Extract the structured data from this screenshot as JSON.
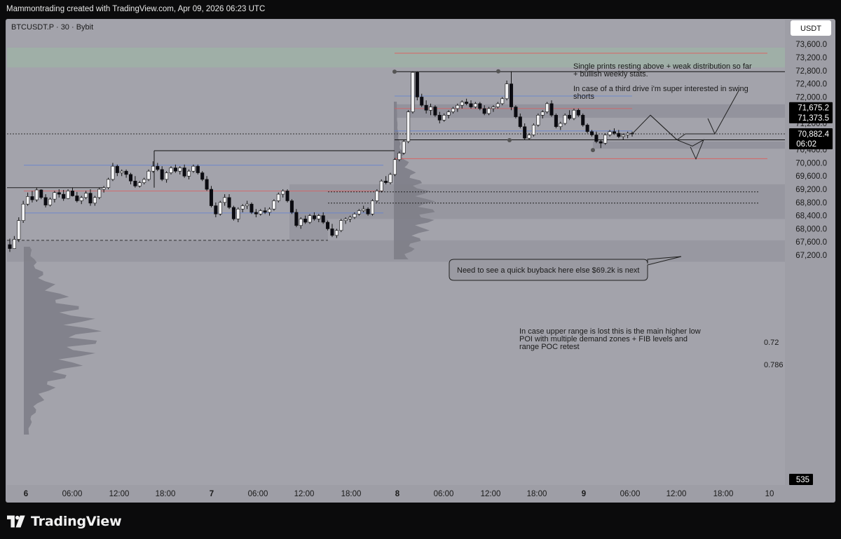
{
  "header": {
    "credit": "Mammontrading created with TradingView.com, Apr 09, 2026 06:23 UTC"
  },
  "symbol_label": "BTCUSDT.P · 30 · Bybit",
  "currency_button": "USDT",
  "brand": {
    "name": "TradingView",
    "logo_icon": "tradingview-logo-icon"
  },
  "colors": {
    "chart_bg": "#a3a3ab",
    "zone_green": "#9fb2a6",
    "zone_dark": "#91919a",
    "candle_bull": "#f2f2f4",
    "candle_bear": "#0b0b12",
    "line_red": "#e05a5a",
    "line_blue": "#5c7fd6",
    "tag_bg": "#000000"
  },
  "annotations": {
    "note_top_1": "Single prints resting above + weak distribution so far",
    "note_top_2": "+ bullish weekly stats.",
    "note_top_3": "In case of a third drive i'm super interested in swing",
    "note_top_4": "shorts",
    "callout": "Need to see a quick buyback here else $69.2k is next",
    "note_low_1": "In case upper range is lost this is the main higher low",
    "note_low_2": "POI with multiple demand zones + FIB levels and",
    "note_low_3": "range POC retest",
    "fib_072": "0.72",
    "fib_0786": "0.786"
  },
  "price_tags": {
    "tag1": "71,675.2",
    "tag2": "71,373.5",
    "last_price": "70,882.4",
    "countdown": "06:02",
    "volume": "535"
  },
  "chart_data": {
    "type": "candlestick",
    "title": "BTCUSDT.P · 30 · Bybit",
    "ylim": [
      67000,
      73900
    ],
    "y_ticks": [
      "73,600.0",
      "73,200.0",
      "72,800.0",
      "72,400.0",
      "72,000.0",
      "71,600.0",
      "71,200.0",
      "70,800.0",
      "70,400.0",
      "70,000.0",
      "69,600.0",
      "69,200.0",
      "68,800.0",
      "68,400.0",
      "68,000.0",
      "67,600.0",
      "67,200.0"
    ],
    "x_ticks": [
      "6",
      "06:00",
      "12:00",
      "18:00",
      "7",
      "06:00",
      "12:00",
      "18:00",
      "8",
      "06:00",
      "12:00",
      "18:00",
      "9",
      "06:00",
      "12:00",
      "18:00",
      "10"
    ],
    "key_levels": {
      "range_high": 72770,
      "range_low": 70700,
      "upper_red": 71650,
      "upper_blue": 72030,
      "upper_red_2": 73330,
      "mid_blue": 70970,
      "lower_red": 70130,
      "left_blue": 69930,
      "left_red": 69150,
      "left_blue_low": 68480,
      "fib_072": 69120,
      "fib_0786": 68780,
      "dashed_low": 67650
    },
    "zones": [
      {
        "name": "supply",
        "from": 72900,
        "to": 73500
      },
      {
        "name": "upper",
        "from": 71370,
        "to": 71780
      },
      {
        "name": "demand",
        "from": 70430,
        "to": 70650
      },
      {
        "name": "lower_demand",
        "from": 68300,
        "to": 69350
      },
      {
        "name": "bottom",
        "from": 67000,
        "to": 67650
      }
    ],
    "candles": [
      [
        67520,
        67700,
        67300,
        67400
      ],
      [
        67400,
        67780,
        67390,
        67680
      ],
      [
        67680,
        68350,
        67600,
        68250
      ],
      [
        68250,
        68850,
        68180,
        68750
      ],
      [
        68750,
        69100,
        68700,
        68980
      ],
      [
        68980,
        69150,
        68800,
        68880
      ],
      [
        68880,
        69250,
        68820,
        69180
      ],
      [
        69180,
        69200,
        68900,
        68950
      ],
      [
        68950,
        69050,
        68650,
        68720
      ],
      [
        68720,
        68950,
        68680,
        68900
      ],
      [
        68900,
        69150,
        68800,
        69100
      ],
      [
        69100,
        69200,
        68950,
        69050
      ],
      [
        69050,
        69180,
        68850,
        68920
      ],
      [
        68920,
        69200,
        68900,
        69150
      ],
      [
        69150,
        69250,
        68980,
        69000
      ],
      [
        69000,
        69120,
        68800,
        68850
      ],
      [
        68850,
        69000,
        68750,
        68950
      ],
      [
        68950,
        69150,
        68900,
        69080
      ],
      [
        69080,
        69200,
        68700,
        68780
      ],
      [
        68780,
        69000,
        68700,
        68950
      ],
      [
        68950,
        69250,
        68900,
        69200
      ],
      [
        69200,
        69300,
        69100,
        69250
      ],
      [
        69250,
        69550,
        69200,
        69500
      ],
      [
        69500,
        70000,
        69450,
        69900
      ],
      [
        69900,
        69950,
        69600,
        69700
      ],
      [
        69700,
        69800,
        69600,
        69750
      ],
      [
        69750,
        69800,
        69550,
        69650
      ],
      [
        69650,
        69700,
        69350,
        69450
      ],
      [
        69450,
        69600,
        69250,
        69300
      ],
      [
        69300,
        69450,
        69250,
        69400
      ],
      [
        69400,
        69550,
        69350,
        69500
      ],
      [
        69500,
        69800,
        69450,
        69750
      ],
      [
        69750,
        70050,
        69700,
        69900
      ],
      [
        69900,
        70000,
        69750,
        69800
      ],
      [
        69800,
        69900,
        69450,
        69500
      ],
      [
        69500,
        69750,
        69400,
        69700
      ],
      [
        69700,
        69900,
        69650,
        69850
      ],
      [
        69850,
        69950,
        69700,
        69750
      ],
      [
        69750,
        69900,
        69650,
        69850
      ],
      [
        69850,
        69950,
        69550,
        69600
      ],
      [
        69600,
        69800,
        69500,
        69750
      ],
      [
        69750,
        69950,
        69700,
        69900
      ],
      [
        69900,
        69950,
        69650,
        69700
      ],
      [
        69700,
        69750,
        69450,
        69500
      ],
      [
        69500,
        69600,
        69150,
        69200
      ],
      [
        69200,
        69300,
        68650,
        68700
      ],
      [
        68700,
        68800,
        68350,
        68450
      ],
      [
        68450,
        68850,
        68400,
        68800
      ],
      [
        68800,
        69050,
        68700,
        68950
      ],
      [
        68950,
        69050,
        68600,
        68650
      ],
      [
        68650,
        68700,
        68250,
        68300
      ],
      [
        68300,
        68650,
        68200,
        68600
      ],
      [
        68600,
        68750,
        68500,
        68700
      ],
      [
        68700,
        68850,
        68600,
        68750
      ],
      [
        68750,
        68800,
        68450,
        68500
      ],
      [
        68500,
        68600,
        68350,
        68450
      ],
      [
        68450,
        68600,
        68400,
        68550
      ],
      [
        68550,
        68650,
        68450,
        68500
      ],
      [
        68500,
        68650,
        68400,
        68600
      ],
      [
        68600,
        68900,
        68550,
        68850
      ],
      [
        68850,
        69100,
        68800,
        69050
      ],
      [
        69050,
        69200,
        68950,
        69150
      ],
      [
        69150,
        69200,
        68800,
        68850
      ],
      [
        68850,
        68900,
        68450,
        68500
      ],
      [
        68500,
        68600,
        68050,
        68100
      ],
      [
        68100,
        68350,
        68000,
        68300
      ],
      [
        68300,
        68400,
        68150,
        68200
      ],
      [
        68200,
        68450,
        68150,
        68400
      ],
      [
        68400,
        68500,
        68250,
        68300
      ],
      [
        68300,
        68450,
        68200,
        68400
      ],
      [
        68400,
        68500,
        68150,
        68200
      ],
      [
        68200,
        68250,
        67950,
        68000
      ],
      [
        68000,
        68150,
        67750,
        67800
      ],
      [
        67800,
        68000,
        67720,
        67950
      ],
      [
        67950,
        68300,
        67900,
        68250
      ],
      [
        68250,
        68350,
        68150,
        68300
      ],
      [
        68300,
        68400,
        68200,
        68350
      ],
      [
        68350,
        68500,
        68300,
        68450
      ],
      [
        68450,
        68600,
        68400,
        68550
      ],
      [
        68550,
        68700,
        68500,
        68600
      ],
      [
        68600,
        68650,
        68400,
        68450
      ],
      [
        68450,
        68900,
        68400,
        68850
      ],
      [
        68850,
        69200,
        68800,
        69150
      ],
      [
        69150,
        69500,
        69100,
        69450
      ],
      [
        69450,
        69600,
        69350,
        69400
      ],
      [
        69400,
        69700,
        69350,
        69650
      ],
      [
        69650,
        70150,
        69600,
        70100
      ],
      [
        70100,
        70350,
        70050,
        70300
      ],
      [
        70300,
        70700,
        70250,
        70650
      ],
      [
        70650,
        71600,
        70600,
        71550
      ],
      [
        71550,
        72780,
        71500,
        72750
      ],
      [
        72750,
        72780,
        71900,
        72000
      ],
      [
        72000,
        72100,
        71700,
        71750
      ],
      [
        71750,
        71900,
        71500,
        71600
      ],
      [
        71600,
        71800,
        71450,
        71700
      ],
      [
        71700,
        71750,
        71400,
        71450
      ],
      [
        71450,
        71550,
        71200,
        71300
      ],
      [
        71300,
        71500,
        71250,
        71450
      ],
      [
        71450,
        71600,
        71350,
        71550
      ],
      [
        71550,
        71700,
        71500,
        71650
      ],
      [
        71650,
        71800,
        71550,
        71750
      ],
      [
        71750,
        71900,
        71650,
        71850
      ],
      [
        71850,
        71950,
        71750,
        71800
      ],
      [
        71800,
        71900,
        71650,
        71700
      ],
      [
        71700,
        71850,
        71650,
        71800
      ],
      [
        71800,
        71850,
        71600,
        71650
      ],
      [
        71650,
        71750,
        71450,
        71500
      ],
      [
        71500,
        71700,
        71450,
        71650
      ],
      [
        71650,
        71750,
        71550,
        71700
      ],
      [
        71700,
        71850,
        71650,
        71800
      ],
      [
        71800,
        72000,
        71750,
        71950
      ],
      [
        71950,
        72500,
        71900,
        72400
      ],
      [
        72400,
        72780,
        71600,
        71700
      ],
      [
        71700,
        71750,
        71350,
        71400
      ],
      [
        71400,
        71500,
        71050,
        71100
      ],
      [
        71100,
        71200,
        70700,
        70750
      ],
      [
        70750,
        70900,
        70700,
        70850
      ],
      [
        70850,
        71200,
        70800,
        71150
      ],
      [
        71150,
        71500,
        71100,
        71450
      ],
      [
        71450,
        71600,
        71350,
        71550
      ],
      [
        71550,
        71850,
        71500,
        71800
      ],
      [
        71800,
        71900,
        71400,
        71450
      ],
      [
        71450,
        71500,
        71050,
        71100
      ],
      [
        71100,
        71250,
        71000,
        71200
      ],
      [
        71200,
        71500,
        71150,
        71450
      ],
      [
        71450,
        71600,
        71300,
        71350
      ],
      [
        71350,
        71650,
        71300,
        71600
      ],
      [
        71600,
        71650,
        71400,
        71450
      ],
      [
        71450,
        71500,
        71100,
        71150
      ],
      [
        71150,
        71200,
        70900,
        70950
      ],
      [
        70950,
        71000,
        70800,
        70850
      ],
      [
        70850,
        70950,
        70600,
        70650
      ],
      [
        70650,
        70700,
        70450,
        70600
      ],
      [
        70600,
        70900,
        70550,
        70850
      ],
      [
        70850,
        71000,
        70800,
        70950
      ],
      [
        70950,
        71050,
        70850,
        70900
      ],
      [
        70900,
        71000,
        70750,
        70800
      ],
      [
        70800,
        70900,
        70700,
        70850
      ],
      [
        70850,
        70950,
        70750,
        70900
      ],
      [
        70900,
        70950,
        70800,
        70880
      ]
    ]
  }
}
